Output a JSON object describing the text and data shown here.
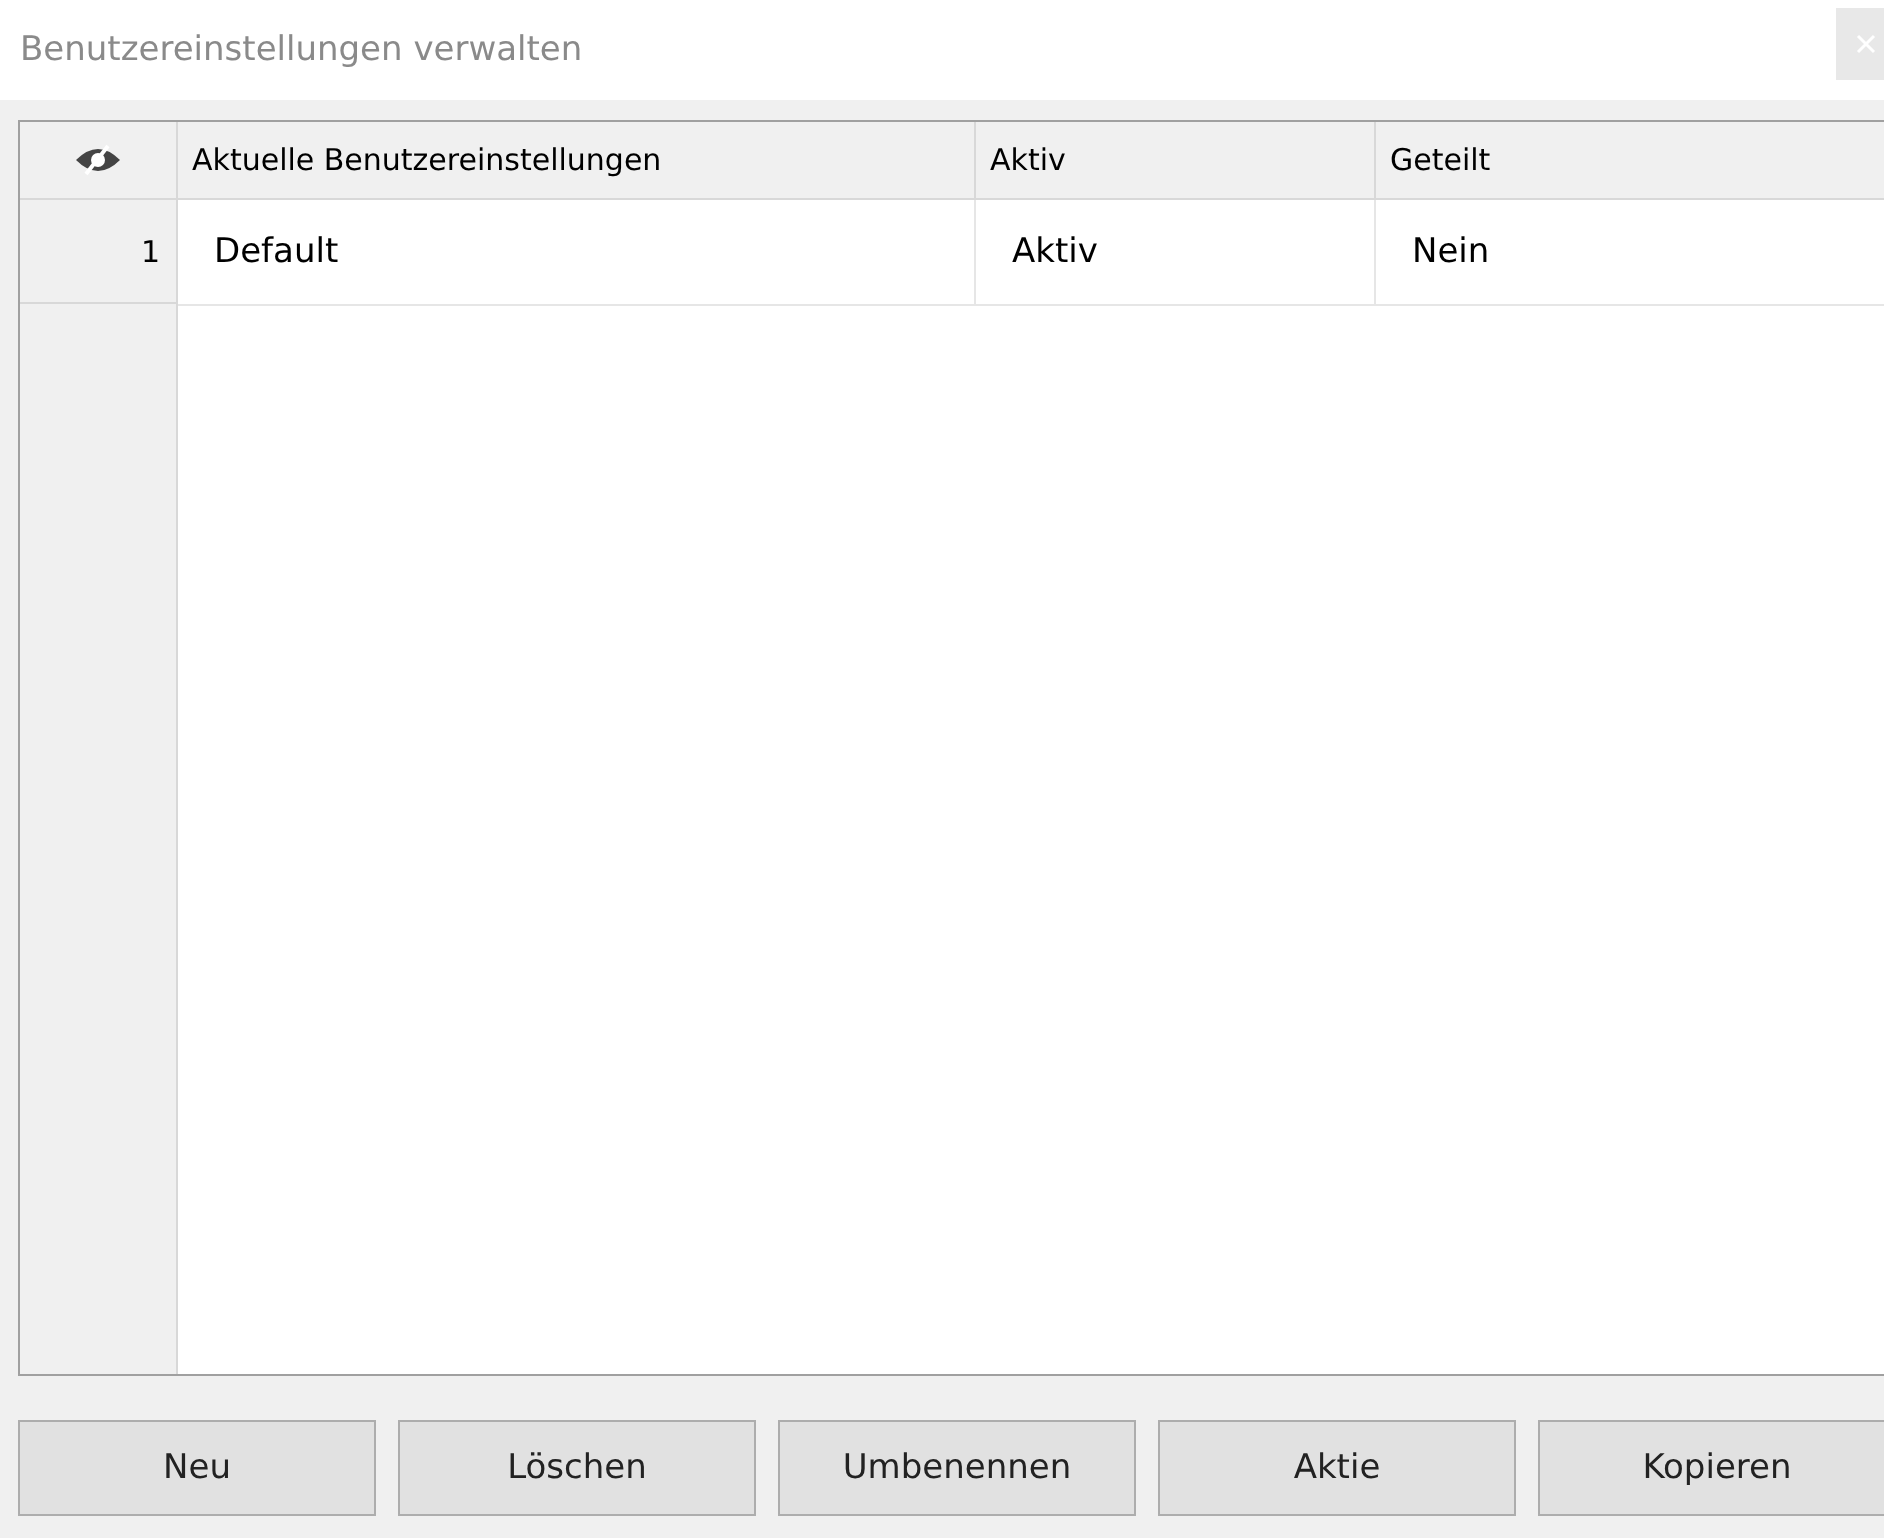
{
  "window": {
    "title": "Benutzereinstellungen verwalten"
  },
  "table": {
    "columns": [
      "Aktuelle Benutzereinstellungen",
      "Aktiv",
      "Geteilt"
    ],
    "rows": [
      {
        "number": "1",
        "cells": [
          "Default",
          "Aktiv",
          "Nein"
        ]
      }
    ]
  },
  "buttons": [
    "Neu",
    "Löschen",
    "Umbenennen",
    "Aktie",
    "Kopieren"
  ]
}
